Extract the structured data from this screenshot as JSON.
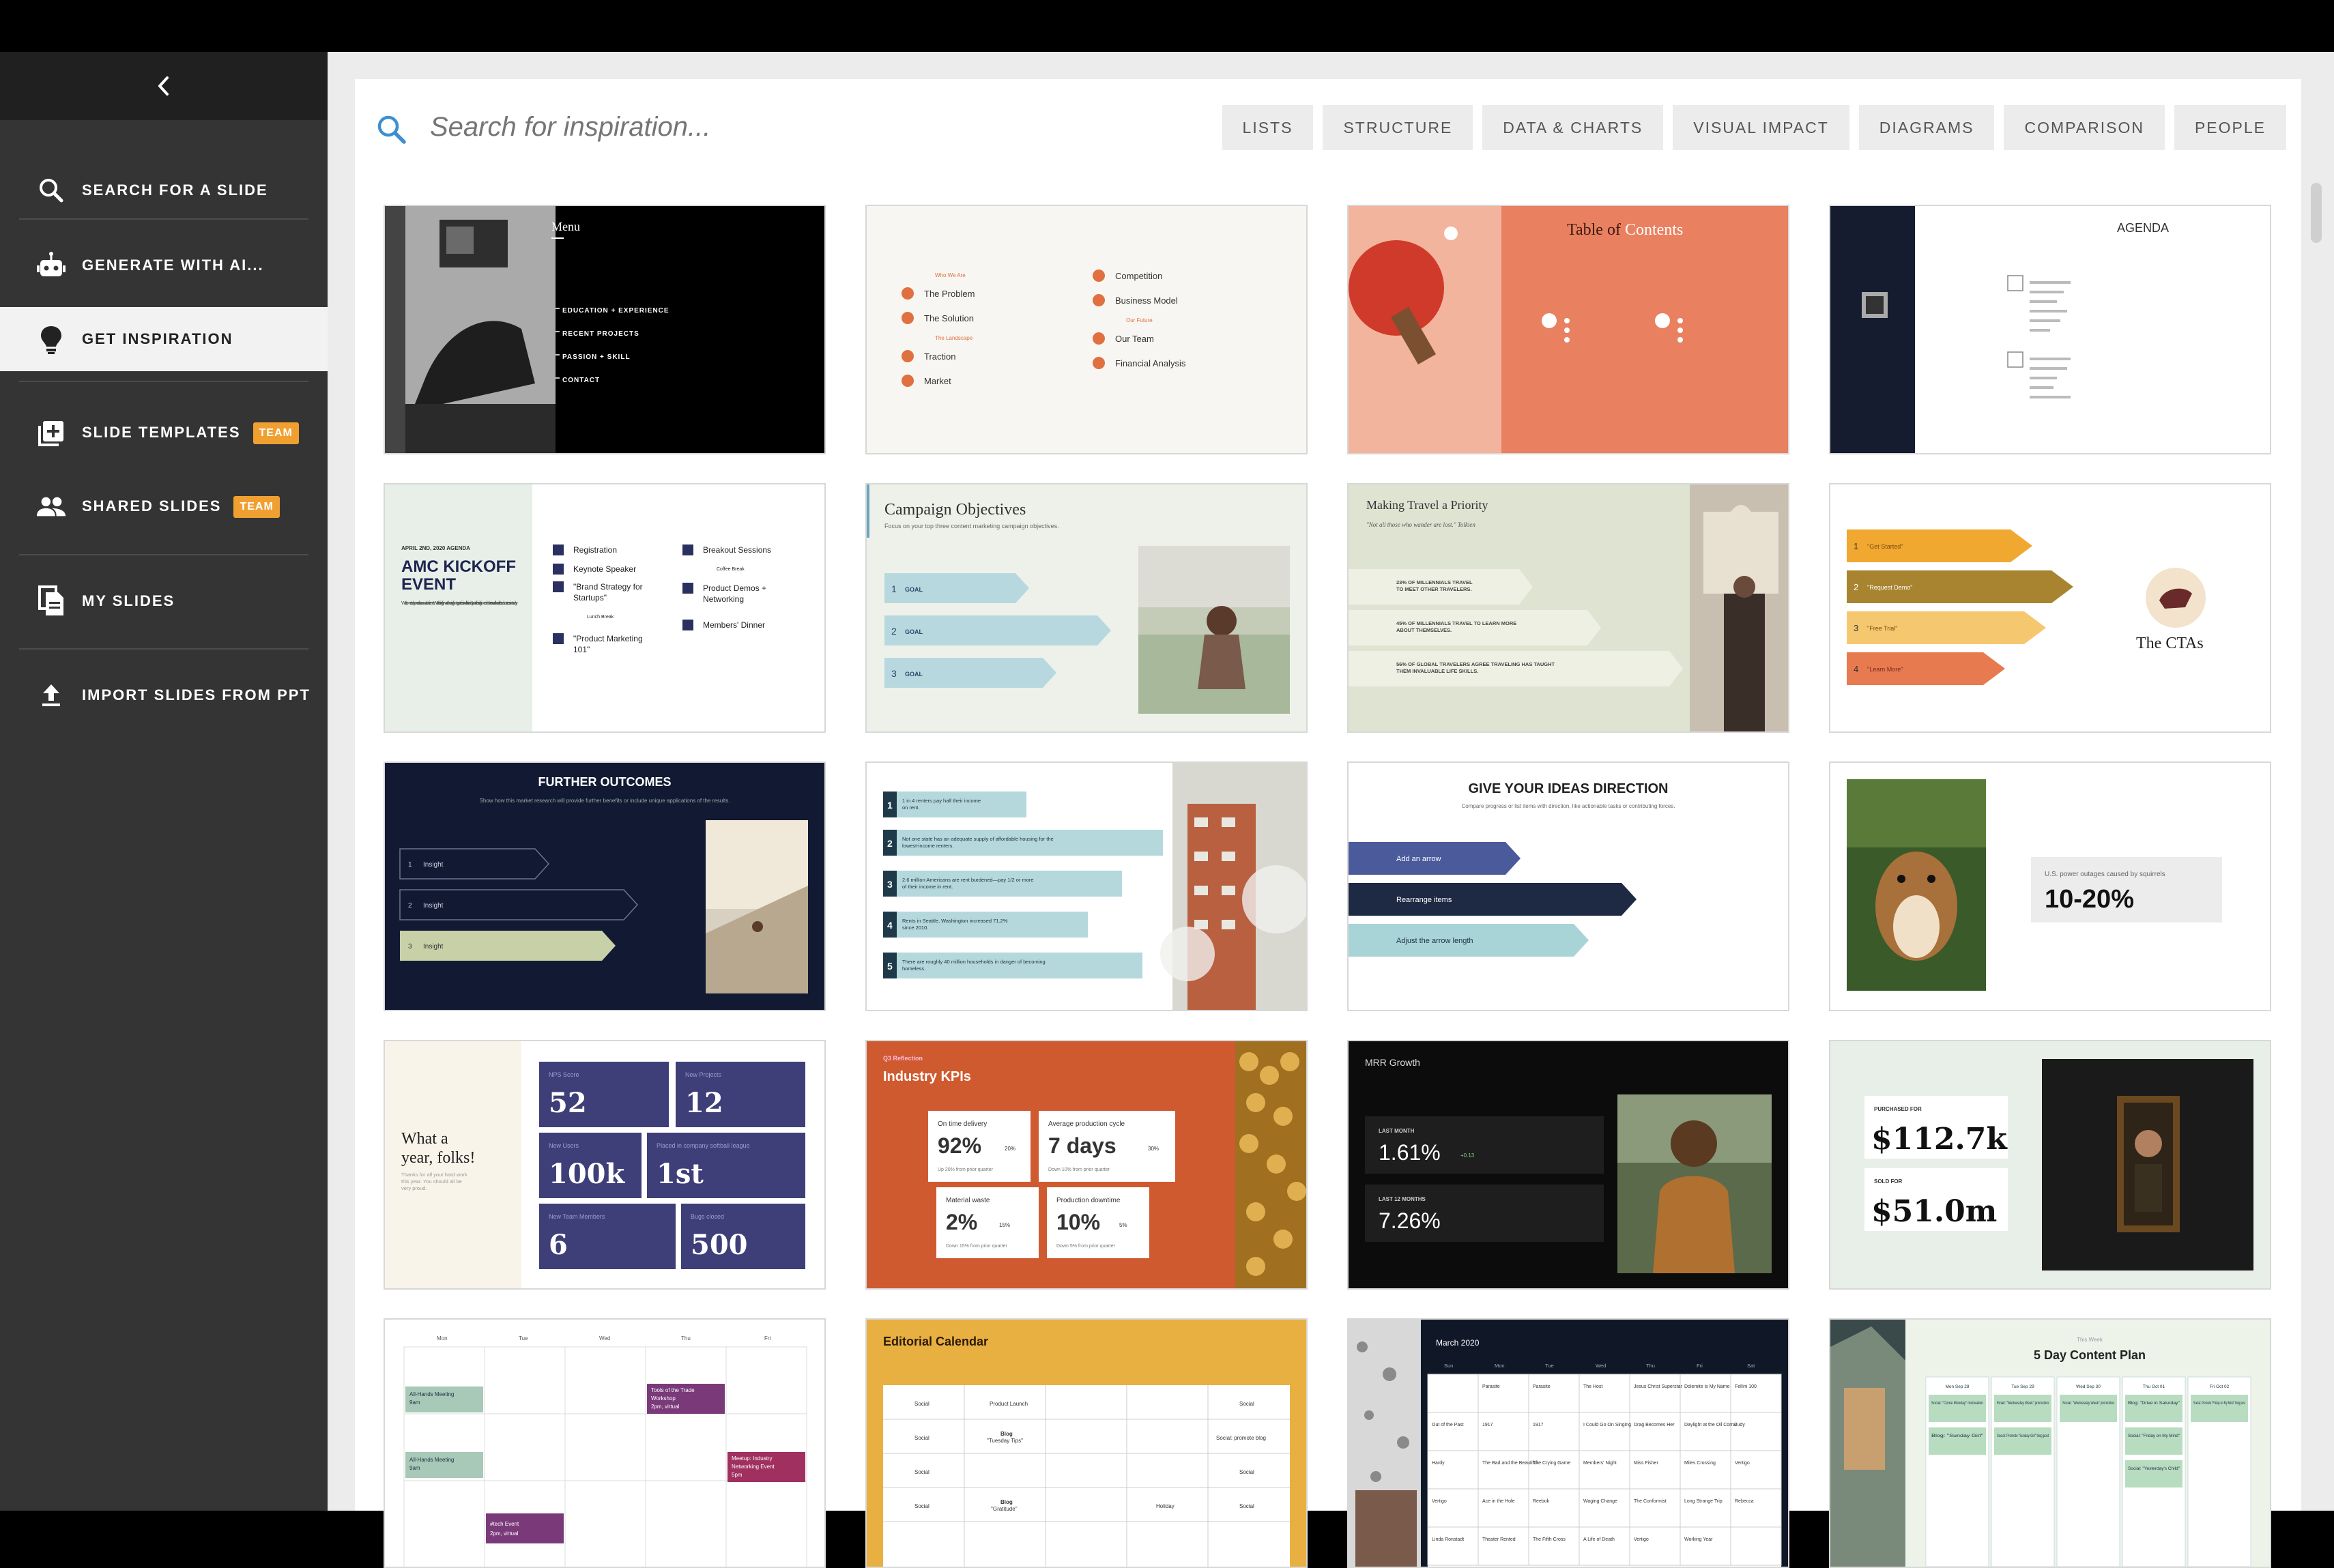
{
  "sidebar": {
    "items": [
      {
        "label": "SEARCH FOR A SLIDE"
      },
      {
        "label": "GENERATE WITH AI..."
      },
      {
        "label": "GET INSPIRATION"
      },
      {
        "label": "SLIDE TEMPLATES",
        "badge": "TEAM"
      },
      {
        "label": "SHARED SLIDES",
        "badge": "TEAM"
      },
      {
        "label": "MY SLIDES"
      },
      {
        "label": "IMPORT SLIDES FROM PPT"
      }
    ]
  },
  "search": {
    "placeholder": "Search for inspiration..."
  },
  "filters": [
    "LISTS",
    "STRUCTURE",
    "DATA & CHARTS",
    "VISUAL IMPACT",
    "DIAGRAMS",
    "COMPARISON",
    "PEOPLE"
  ],
  "colors": {
    "accent": "#f0a030",
    "sidebar": "#343434",
    "search_icon": "#3d8fd1"
  },
  "slides": {
    "menu": {
      "title": "Menu",
      "items": [
        "EDUCATION + EXPERIENCE",
        "RECENT PROJECTS",
        "PASSION + SKILL",
        "CONTACT"
      ]
    },
    "agenda_list": {
      "left": [
        "Who We Are",
        "The Problem",
        "The Solution",
        "The Landscape",
        "Traction",
        "Market"
      ],
      "right": [
        "Competition",
        "Business Model",
        "Our Future",
        "Our Team",
        "Financial Analysis"
      ]
    },
    "toc": {
      "title_a": "Table of",
      "title_b": "Contents"
    },
    "agenda": {
      "title": "AGENDA"
    },
    "kickoff": {
      "date": "APRIL 2ND, 2020 AGENDA",
      "title_1": "AMC KICKOFF",
      "title_2": "EVENT",
      "body": "Welcome to day one of our annual conference. We're looking forward to hearing from top professionals in the industry and learning from each other in our collaborative breakout sessions today.",
      "col1": [
        "Registration",
        "Keynote Speaker",
        "\"Brand Strategy for",
        "Startups\"",
        "Lunch Break",
        "\"Product Marketing",
        "101\""
      ],
      "col2": [
        "Breakout Sessions",
        "Coffee Break",
        "Product Demos +",
        "Networking",
        "Members' Dinner"
      ]
    },
    "campaign": {
      "title": "Campaign Objectives",
      "subtitle": "Focus on your top three content marketing campaign objectives.",
      "goal": "GOAL"
    },
    "travel": {
      "title": "Making Travel a Priority",
      "quote": "\"Not all those who wander are lost.\" Tolkien",
      "items": [
        "23% OF MILLENNIALS TRAVEL",
        "TO MEET OTHER TRAVELERS.",
        "45% OF MILLENNIALS TRAVEL TO LEARN MORE",
        "ABOUT THEMSELVES.",
        "56% OF GLOBAL TRAVELERS AGREE TRAVELING HAS TAUGHT",
        "THEM INVALUABLE LIFE SKILLS."
      ]
    },
    "ctas": {
      "title": "The CTAs",
      "items": [
        "\"Get Started\"",
        "\"Request Demo\"",
        "\"Free Trial\"",
        "\"Learn More\""
      ]
    },
    "outcomes": {
      "title": "FURTHER OUTCOMES",
      "subtitle": "Show how this market research will provide further benefits or include unique applications of the results.",
      "item": "Insight"
    },
    "renters": {
      "items": [
        [
          "1 in 4 renters pay half their income",
          "on rent."
        ],
        [
          "Not one state has an adequate supply of affordable housing for the",
          "lowest-income renters."
        ],
        [
          "2.6 million Americans are rent burdened—pay 1/2 or more",
          "of their income in rent."
        ],
        [
          "Rents in Seattle, Washington increased 71.2%",
          "since 2010."
        ],
        [
          "There are roughly 40 million households in danger of becoming",
          "homeless."
        ]
      ]
    },
    "direction": {
      "title": "GIVE YOUR IDEAS DIRECTION",
      "subtitle": "Compare progress or list items with direction, like actionable tasks or contributing forces.",
      "arrows": [
        "Add an arrow",
        "Rearrange items",
        "Adjust the arrow length"
      ]
    },
    "squirrel": {
      "caption": "U.S. power outages caused by squirrels",
      "value": "10-20%"
    },
    "year": {
      "title_1": "What a",
      "title_2": "year, folks!",
      "body": [
        "Thanks for all your hard work",
        "this year. You should all be",
        "very proud."
      ],
      "stats": [
        {
          "label": "NPS Score",
          "value": "52"
        },
        {
          "label": "New Projects",
          "value": "12"
        },
        {
          "label": "New Users",
          "value": "100k"
        },
        {
          "label": "Placed in company softball league",
          "value": "1st"
        },
        {
          "label": "New Team Members",
          "value": "6"
        },
        {
          "label": "Bugs closed",
          "value": "500"
        }
      ]
    },
    "kpis": {
      "kicker": "Q3 Reflection",
      "title": "Industry KPIs",
      "cards": [
        {
          "label": "On time delivery",
          "value": "92%",
          "delta": "20%",
          "note": "Up 20% from prior quarter"
        },
        {
          "label": "Average production cycle",
          "value": "7 days",
          "delta": "30%",
          "note": "Down 10% from prior quarter"
        },
        {
          "label": "Material waste",
          "value": "2%",
          "delta": "15%",
          "note": "Down 15% from prior quarter"
        },
        {
          "label": "Production downtime",
          "value": "10%",
          "delta": "5%",
          "note": "Down 5% from prior quarter"
        }
      ]
    },
    "mrr": {
      "title": "MRR Growth",
      "rows": [
        {
          "label": "LAST MONTH",
          "value": "1.61%",
          "delta": "+0.13"
        },
        {
          "label": "LAST 12 MONTHS",
          "value": "7.26%"
        }
      ]
    },
    "sales": {
      "rows": [
        {
          "label": "PURCHASED FOR",
          "value": "$112.7k"
        },
        {
          "label": "SOLD FOR",
          "value": "$51.0m"
        }
      ]
    },
    "calendar": {
      "days": [
        "Mon",
        "Tue",
        "Wed",
        "Thu",
        "Fri"
      ],
      "events": [
        "All-Hands Meeting",
        "9am",
        "Tools of the Trade",
        "Workshop",
        "2pm, virtual",
        "All-Hands Meeting",
        "9am",
        "Meetup: Industry",
        "Networking Event",
        "5pm",
        "#tech Event",
        "2pm, virtual"
      ]
    },
    "editorial": {
      "title": "Editorial Calendar",
      "cells": [
        "Social",
        "Product Launch",
        "Social",
        "Social",
        "Blog",
        "\"Tuesday Tips\"",
        "Social: promote blog",
        "Social",
        "Social",
        "Social",
        "Blog",
        "\"Gratitude\"",
        "Holiday",
        "Social"
      ]
    },
    "march": {
      "title": "March 2020",
      "days": [
        "Sun",
        "Mon",
        "Tue",
        "Wed",
        "Thu",
        "Fri",
        "Sat"
      ],
      "cells": [
        "Parasite",
        "Parasite",
        "The Host",
        "Jesus Christ Superstar",
        "Dolemite is My Name",
        "Fellini 100",
        "Out of the Past",
        "1917",
        "1917",
        "I Could Go On Singing",
        "Drag Becomes Her",
        "Daylight at the Oil Corral",
        "Judy",
        "Hardy",
        "The Bad and the Beautiful",
        "The Crying Game",
        "Members' Night",
        "Miss Fisher",
        "Miles Crossing",
        "Vertigo",
        "Vertigo",
        "Ace in the Hole",
        "Reebok",
        "Waging Change",
        "The Conformist",
        "Long Strange Trip",
        "Rebecca",
        "Linda Ronstadt",
        "Theater Rented",
        "The Fifth Cross",
        "A Life of Death",
        "Vertigo",
        "Working Year"
      ]
    },
    "content_plan": {
      "kicker": "This Week",
      "title": "5 Day Content Plan",
      "days": [
        "Mon Sep 28",
        "Tue Sep 29",
        "Wed Sep 30",
        "Thu Oct 01",
        "Fri Oct 02"
      ],
      "items": [
        [
          "Social: \"Come Monday\" motivation",
          "Blog: \"Sunday Girl\""
        ],
        [
          "Email: \"Wednesday Week\" promotion",
          "Social: Promote \"Sunday Girl\" blog post"
        ],
        [
          "Social: \"Wednesday Week\" promotion"
        ],
        [
          "Blog: \"Drive in Saturday\"",
          "Social: \"Friday on My Mind\"",
          "Social: \"Yesterday's Child\""
        ],
        [
          "Social: Promote \"Friday on My Mind\" blog post"
        ]
      ]
    }
  }
}
